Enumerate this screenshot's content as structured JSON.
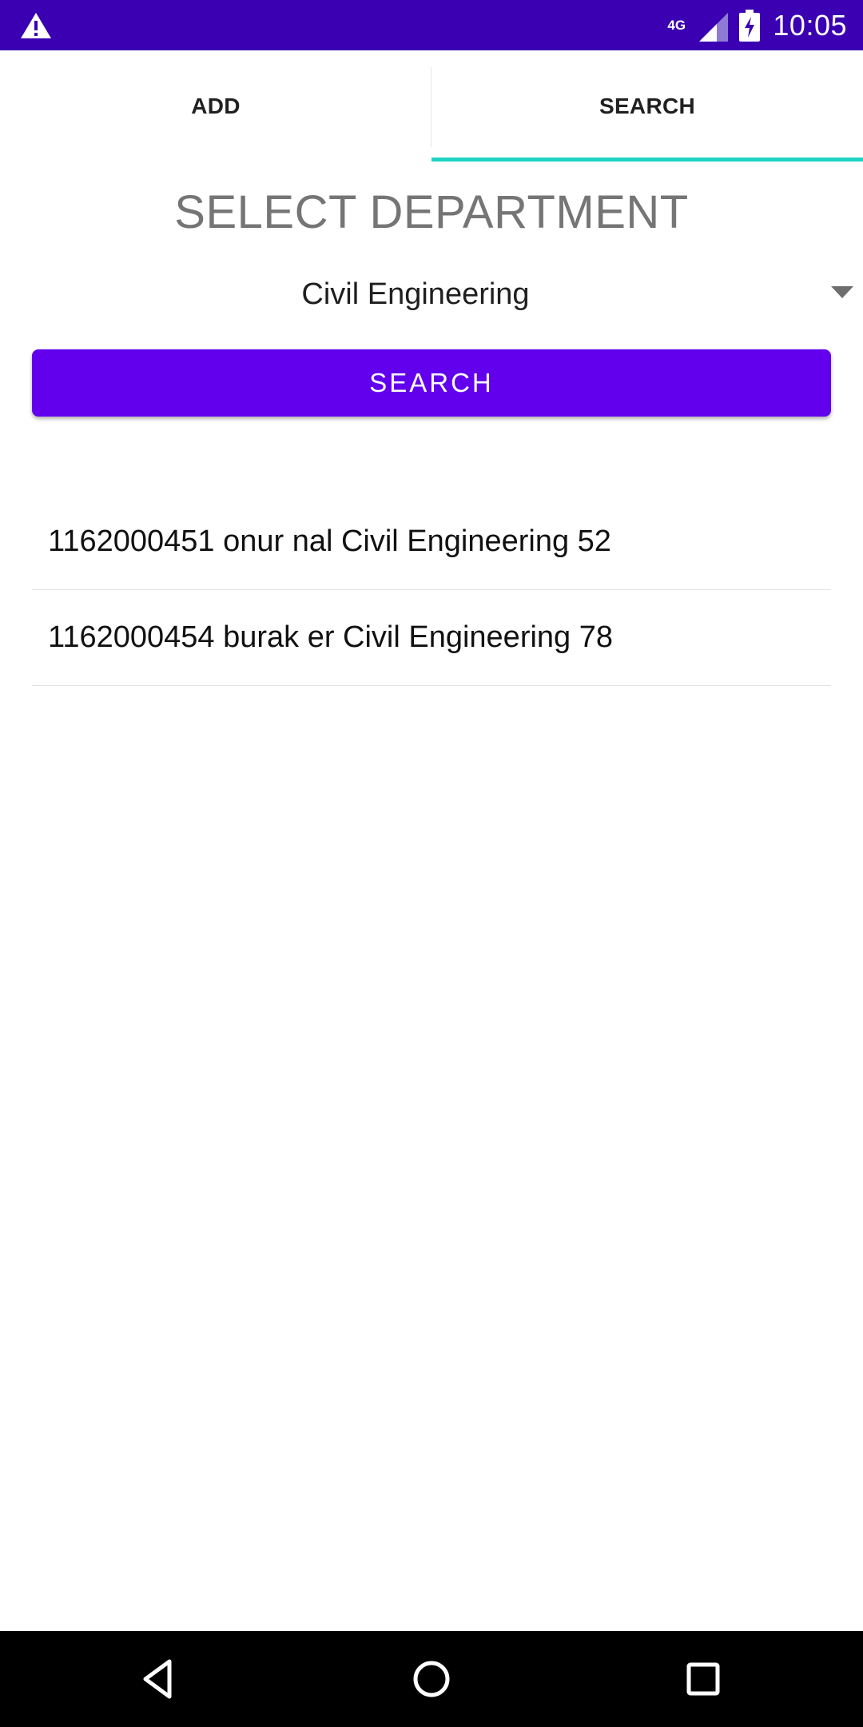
{
  "status_bar": {
    "time": "10:05",
    "network_type": "4G",
    "icons": [
      "warning-icon",
      "signal-icon",
      "battery-charging-icon"
    ]
  },
  "tabs": [
    {
      "label": "ADD",
      "selected": false
    },
    {
      "label": "SEARCH",
      "selected": true
    }
  ],
  "search_page": {
    "title": "SELECT DEPARTMENT",
    "department_selected": "Civil Engineering",
    "search_button_label": "SEARCH",
    "results": [
      "1162000451 onur nal Civil Engineering 52",
      "1162000454 burak er Civil Engineering 78"
    ]
  },
  "nav_bar": {
    "buttons": [
      "back-icon",
      "home-icon",
      "recents-icon"
    ]
  },
  "colors": {
    "status_bar": "#3a00b1",
    "primary": "#6200ee",
    "tab_indicator": "#1ed4c3",
    "title_text": "#757575"
  }
}
